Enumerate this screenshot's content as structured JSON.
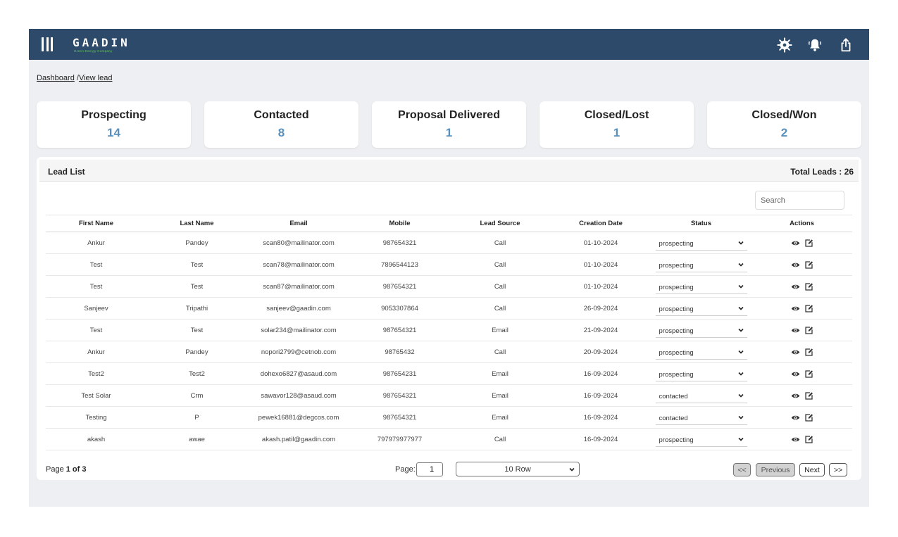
{
  "header": {
    "logo_text": "GAADIN",
    "logo_tagline": "Green Energy Company",
    "icons": [
      "gear-icon",
      "bell-icon",
      "share-icon"
    ]
  },
  "breadcrumb": {
    "dashboard": "Dashboard",
    "separator": " /",
    "current": "View lead"
  },
  "stats": [
    {
      "label": "Prospecting",
      "value": "14"
    },
    {
      "label": "Contacted",
      "value": "8"
    },
    {
      "label": "Proposal Delivered",
      "value": "1"
    },
    {
      "label": "Closed/Lost",
      "value": "1"
    },
    {
      "label": "Closed/Won",
      "value": "2"
    }
  ],
  "lead_list": {
    "title": "Lead List",
    "total": "Total Leads : 26",
    "search_placeholder": "Search",
    "columns": [
      "First Name",
      "Last Name",
      "Email",
      "Mobile",
      "Lead Source",
      "Creation Date",
      "Status",
      "Actions"
    ],
    "rows": [
      {
        "first": "Ankur",
        "last": "Pandey",
        "email": "scan80@mailinator.com",
        "mobile": "987654321",
        "source": "Call",
        "date": "01-10-2024",
        "status": "prospecting"
      },
      {
        "first": "Test",
        "last": "Test",
        "email": "scan78@mailinator.com",
        "mobile": "7896544123",
        "source": "Call",
        "date": "01-10-2024",
        "status": "prospecting"
      },
      {
        "first": "Test",
        "last": "Test",
        "email": "scan87@mailinator.com",
        "mobile": "987654321",
        "source": "Call",
        "date": "01-10-2024",
        "status": "prospecting"
      },
      {
        "first": "Sanjeev",
        "last": "Tripathi",
        "email": "sanjeev@gaadin.com",
        "mobile": "9053307864",
        "source": "Call",
        "date": "26-09-2024",
        "status": "prospecting"
      },
      {
        "first": "Test",
        "last": "Test",
        "email": "solar234@mailinator.com",
        "mobile": "987654321",
        "source": "Email",
        "date": "21-09-2024",
        "status": "prospecting"
      },
      {
        "first": "Ankur",
        "last": "Pandey",
        "email": "nopori2799@cetnob.com",
        "mobile": "98765432",
        "source": "Call",
        "date": "20-09-2024",
        "status": "prospecting"
      },
      {
        "first": "Test2",
        "last": "Test2",
        "email": "dohexo6827@asaud.com",
        "mobile": "987654231",
        "source": "Email",
        "date": "16-09-2024",
        "status": "prospecting"
      },
      {
        "first": "Test Solar",
        "last": "Crm",
        "email": "sawavor128@asaud.com",
        "mobile": "987654321",
        "source": "Email",
        "date": "16-09-2024",
        "status": "contacted"
      },
      {
        "first": "Testing",
        "last": "P",
        "email": "pewek16881@degcos.com",
        "mobile": "987654321",
        "source": "Email",
        "date": "16-09-2024",
        "status": "contacted"
      },
      {
        "first": "akash",
        "last": "awae",
        "email": "akash.patil@gaadin.com",
        "mobile": "797979977977",
        "source": "Call",
        "date": "16-09-2024",
        "status": "prospecting"
      }
    ]
  },
  "pagination": {
    "page_prefix": "Page ",
    "page_info": "1 of 3",
    "page_label": "Page:",
    "page_value": "1",
    "rows_option": "10 Row",
    "first": "<<",
    "previous": "Previous",
    "next": "Next",
    "last": ">>"
  }
}
